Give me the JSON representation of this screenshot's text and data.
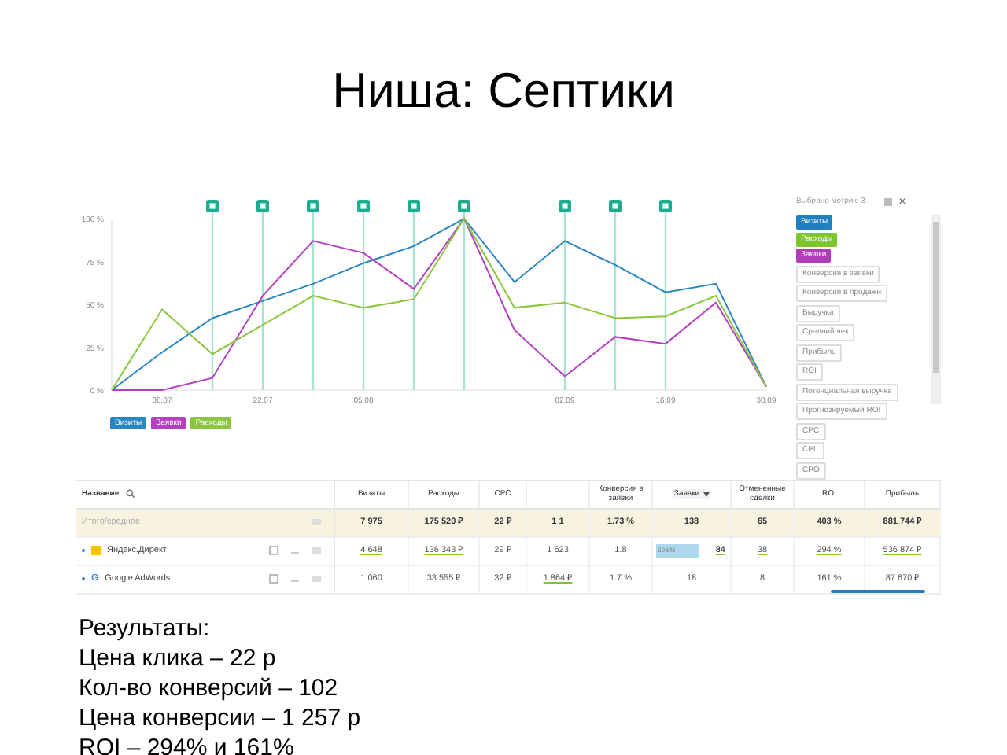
{
  "slide": {
    "title": "Ниша: Септики"
  },
  "chart": {
    "chart_data": {
      "type": "line",
      "categories": [
        null,
        "08.07",
        null,
        "22.07",
        null,
        "05.08",
        null,
        null,
        null,
        "02.09",
        null,
        "16.09",
        null,
        "30.09"
      ],
      "ylim": [
        0,
        100
      ],
      "yticks": [
        {
          "value": 0,
          "label": "0 %"
        },
        {
          "value": 25,
          "label": "25 %"
        },
        {
          "value": 50,
          "label": "50 %"
        },
        {
          "value": 75,
          "label": "75 %"
        },
        {
          "value": 100,
          "label": "100 %"
        }
      ],
      "series": [
        {
          "name": "Визиты",
          "color": "#2a86c0",
          "values": [
            0,
            22,
            42,
            52,
            62,
            74,
            84,
            100,
            63,
            87,
            73,
            57,
            62,
            2
          ]
        },
        {
          "name": "Заявки",
          "color": "#b53fc1",
          "values": [
            0,
            0,
            7,
            55,
            87,
            80,
            59,
            100,
            35,
            8,
            31,
            27,
            51,
            2
          ]
        },
        {
          "name": "Расходы",
          "color": "#8cc63f",
          "values": [
            0,
            47,
            21,
            38,
            55,
            48,
            53,
            100,
            48,
            51,
            42,
            43,
            55,
            2
          ]
        }
      ],
      "grid": true
    }
  },
  "metrics_panel": {
    "title": "Выбрано метрик: 3",
    "close": "✕",
    "items": [
      {
        "label": "Визиты",
        "selected": true,
        "color": "#1f7fbf"
      },
      {
        "label": "Расходы",
        "selected": true,
        "color": "#7cc52b"
      },
      {
        "label": "Заявки",
        "selected": true,
        "color": "#b23bb8"
      },
      {
        "label": "Конверсия в заявки",
        "selected": false
      },
      {
        "label": "Конверсия в продажи",
        "selected": false
      },
      {
        "label": "Выручка",
        "selected": false
      },
      {
        "label": "Средний чек",
        "selected": false
      },
      {
        "label": "Прибыль",
        "selected": false
      },
      {
        "label": "ROI",
        "selected": false
      },
      {
        "label": "Потенциальная выручка",
        "selected": false
      },
      {
        "label": "Прогнозируемый ROI",
        "selected": false
      },
      {
        "label": "CPC",
        "selected": false
      },
      {
        "label": "CPL",
        "selected": false
      },
      {
        "label": "CPO",
        "selected": false
      }
    ]
  },
  "table": {
    "columns": [
      {
        "label": "Название",
        "sorted": false
      },
      {
        "label": "Визиты",
        "sorted": false
      },
      {
        "label": "Расходы",
        "sorted": false
      },
      {
        "label": "CPC",
        "sorted": false
      },
      {
        "sorted": false
      },
      {
        "label": "Конверсия в заявки",
        "sorted": false
      },
      {
        "label": "Заявки",
        "sorted": true
      },
      {
        "label": "Отмененные сделки",
        "sorted": false
      },
      {
        "label": "ROI",
        "sorted": false
      },
      {
        "label": "Прибыль",
        "sorted": false
      }
    ],
    "rows": [
      {
        "kind": "total",
        "cells": [
          {
            "text": "Итого/среднее",
            "underlined": false
          },
          {
            "text": "7 975",
            "underlined": false
          },
          {
            "text": "175 520 ₽",
            "underlined": false
          },
          {
            "text": "22 ₽",
            "underlined": false
          },
          {
            "text": "1 1",
            "underlined": false
          },
          {
            "text": "1.73 %",
            "underlined": false
          },
          {
            "text": "138",
            "underlined": false
          },
          {
            "text": "65",
            "underlined": false
          },
          {
            "text": "403 %",
            "underlined": false
          },
          {
            "text": "881 744 ₽",
            "underlined": false
          }
        ]
      },
      {
        "kind": "yandex",
        "checked": false,
        "cells": [
          {
            "text": "Яндекс.Директ",
            "underlined": false
          },
          {
            "text": "4 648",
            "underlined": true
          },
          {
            "text": "136 343 ₽",
            "underlined": true
          },
          {
            "text": "29 ₽",
            "underlined": false
          },
          {
            "text": "1 623",
            "underlined": false
          },
          {
            "text": "1.8",
            "underlined": false
          },
          {
            "text": "84",
            "underlined": true,
            "bar_label": "60.9%",
            "level": 0.609
          },
          {
            "text": "38",
            "underlined": true
          },
          {
            "text": "294 %",
            "underlined": true
          },
          {
            "text": "536 874 ₽",
            "underlined": true
          }
        ]
      },
      {
        "kind": "google",
        "logo": "G",
        "checked": false,
        "cells": [
          {
            "text": "Google AdWords",
            "underlined": false
          },
          {
            "text": "1 060",
            "underlined": false
          },
          {
            "text": "33 555 ₽",
            "underlined": false
          },
          {
            "text": "32 ₽",
            "underlined": false
          },
          {
            "text": "1 864 ₽",
            "underlined": true
          },
          {
            "text": "1.7 %",
            "underlined": false
          },
          {
            "text": "18",
            "underlined": false
          },
          {
            "text": "8",
            "underlined": false
          },
          {
            "text": "161 %",
            "underlined": false
          },
          {
            "text": "87 670 ₽",
            "underlined": false
          }
        ]
      }
    ]
  },
  "results": [
    "Результаты:",
    "Цена клика – 22 р",
    "Кол-во конверсий – 102",
    "Цена конверсии – 1 257 р",
    "ROI – 294% и 161%"
  ]
}
